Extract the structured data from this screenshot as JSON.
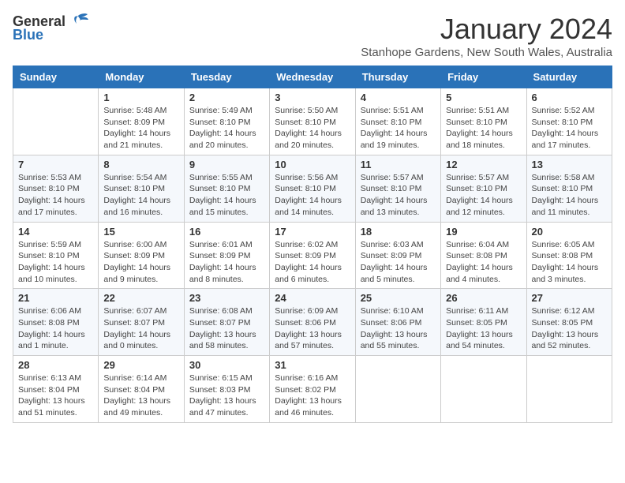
{
  "header": {
    "logo_general": "General",
    "logo_blue": "Blue",
    "month_title": "January 2024",
    "subtitle": "Stanhope Gardens, New South Wales, Australia"
  },
  "days_of_week": [
    "Sunday",
    "Monday",
    "Tuesday",
    "Wednesday",
    "Thursday",
    "Friday",
    "Saturday"
  ],
  "weeks": [
    [
      {
        "day": "",
        "info": ""
      },
      {
        "day": "1",
        "info": "Sunrise: 5:48 AM\nSunset: 8:09 PM\nDaylight: 14 hours\nand 21 minutes."
      },
      {
        "day": "2",
        "info": "Sunrise: 5:49 AM\nSunset: 8:10 PM\nDaylight: 14 hours\nand 20 minutes."
      },
      {
        "day": "3",
        "info": "Sunrise: 5:50 AM\nSunset: 8:10 PM\nDaylight: 14 hours\nand 20 minutes."
      },
      {
        "day": "4",
        "info": "Sunrise: 5:51 AM\nSunset: 8:10 PM\nDaylight: 14 hours\nand 19 minutes."
      },
      {
        "day": "5",
        "info": "Sunrise: 5:51 AM\nSunset: 8:10 PM\nDaylight: 14 hours\nand 18 minutes."
      },
      {
        "day": "6",
        "info": "Sunrise: 5:52 AM\nSunset: 8:10 PM\nDaylight: 14 hours\nand 17 minutes."
      }
    ],
    [
      {
        "day": "7",
        "info": "Sunrise: 5:53 AM\nSunset: 8:10 PM\nDaylight: 14 hours\nand 17 minutes."
      },
      {
        "day": "8",
        "info": "Sunrise: 5:54 AM\nSunset: 8:10 PM\nDaylight: 14 hours\nand 16 minutes."
      },
      {
        "day": "9",
        "info": "Sunrise: 5:55 AM\nSunset: 8:10 PM\nDaylight: 14 hours\nand 15 minutes."
      },
      {
        "day": "10",
        "info": "Sunrise: 5:56 AM\nSunset: 8:10 PM\nDaylight: 14 hours\nand 14 minutes."
      },
      {
        "day": "11",
        "info": "Sunrise: 5:57 AM\nSunset: 8:10 PM\nDaylight: 14 hours\nand 13 minutes."
      },
      {
        "day": "12",
        "info": "Sunrise: 5:57 AM\nSunset: 8:10 PM\nDaylight: 14 hours\nand 12 minutes."
      },
      {
        "day": "13",
        "info": "Sunrise: 5:58 AM\nSunset: 8:10 PM\nDaylight: 14 hours\nand 11 minutes."
      }
    ],
    [
      {
        "day": "14",
        "info": "Sunrise: 5:59 AM\nSunset: 8:10 PM\nDaylight: 14 hours\nand 10 minutes."
      },
      {
        "day": "15",
        "info": "Sunrise: 6:00 AM\nSunset: 8:09 PM\nDaylight: 14 hours\nand 9 minutes."
      },
      {
        "day": "16",
        "info": "Sunrise: 6:01 AM\nSunset: 8:09 PM\nDaylight: 14 hours\nand 8 minutes."
      },
      {
        "day": "17",
        "info": "Sunrise: 6:02 AM\nSunset: 8:09 PM\nDaylight: 14 hours\nand 6 minutes."
      },
      {
        "day": "18",
        "info": "Sunrise: 6:03 AM\nSunset: 8:09 PM\nDaylight: 14 hours\nand 5 minutes."
      },
      {
        "day": "19",
        "info": "Sunrise: 6:04 AM\nSunset: 8:08 PM\nDaylight: 14 hours\nand 4 minutes."
      },
      {
        "day": "20",
        "info": "Sunrise: 6:05 AM\nSunset: 8:08 PM\nDaylight: 14 hours\nand 3 minutes."
      }
    ],
    [
      {
        "day": "21",
        "info": "Sunrise: 6:06 AM\nSunset: 8:08 PM\nDaylight: 14 hours\nand 1 minute."
      },
      {
        "day": "22",
        "info": "Sunrise: 6:07 AM\nSunset: 8:07 PM\nDaylight: 14 hours\nand 0 minutes."
      },
      {
        "day": "23",
        "info": "Sunrise: 6:08 AM\nSunset: 8:07 PM\nDaylight: 13 hours\nand 58 minutes."
      },
      {
        "day": "24",
        "info": "Sunrise: 6:09 AM\nSunset: 8:06 PM\nDaylight: 13 hours\nand 57 minutes."
      },
      {
        "day": "25",
        "info": "Sunrise: 6:10 AM\nSunset: 8:06 PM\nDaylight: 13 hours\nand 55 minutes."
      },
      {
        "day": "26",
        "info": "Sunrise: 6:11 AM\nSunset: 8:05 PM\nDaylight: 13 hours\nand 54 minutes."
      },
      {
        "day": "27",
        "info": "Sunrise: 6:12 AM\nSunset: 8:05 PM\nDaylight: 13 hours\nand 52 minutes."
      }
    ],
    [
      {
        "day": "28",
        "info": "Sunrise: 6:13 AM\nSunset: 8:04 PM\nDaylight: 13 hours\nand 51 minutes."
      },
      {
        "day": "29",
        "info": "Sunrise: 6:14 AM\nSunset: 8:04 PM\nDaylight: 13 hours\nand 49 minutes."
      },
      {
        "day": "30",
        "info": "Sunrise: 6:15 AM\nSunset: 8:03 PM\nDaylight: 13 hours\nand 47 minutes."
      },
      {
        "day": "31",
        "info": "Sunrise: 6:16 AM\nSunset: 8:02 PM\nDaylight: 13 hours\nand 46 minutes."
      },
      {
        "day": "",
        "info": ""
      },
      {
        "day": "",
        "info": ""
      },
      {
        "day": "",
        "info": ""
      }
    ]
  ]
}
